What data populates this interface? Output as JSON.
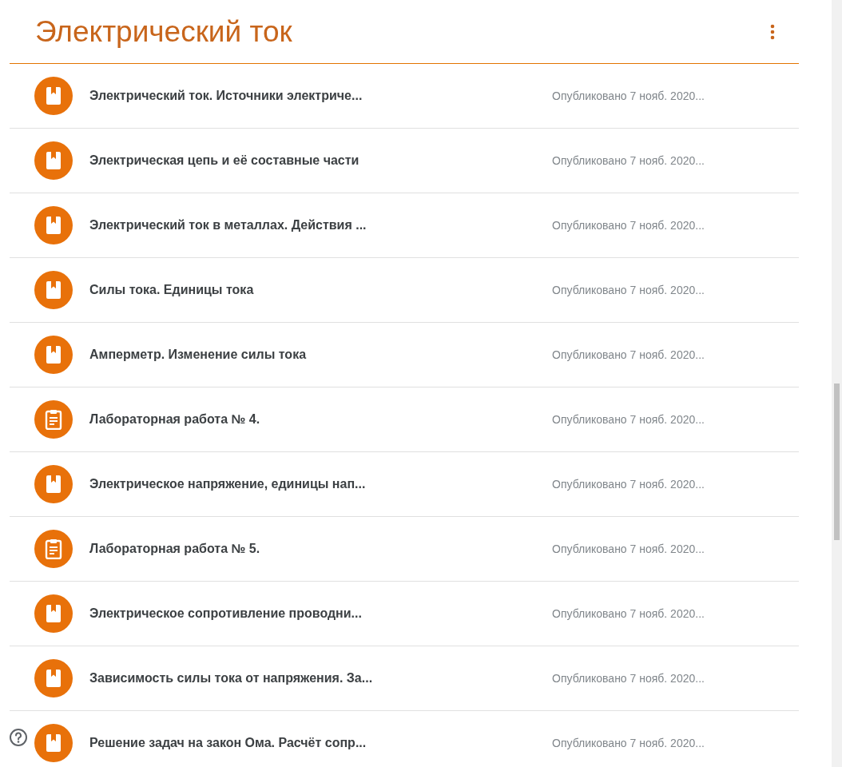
{
  "topic": {
    "title": "Электрический ток"
  },
  "items": [
    {
      "kind": "material",
      "title": "Электрический ток. Источники электриче...",
      "date": "Опубликовано 7 нояб. 2020..."
    },
    {
      "kind": "material",
      "title": "Электрическая цепь и её составные части",
      "date": "Опубликовано 7 нояб. 2020..."
    },
    {
      "kind": "material",
      "title": "Электрический ток в металлах. Действия ...",
      "date": "Опубликовано 7 нояб. 2020..."
    },
    {
      "kind": "material",
      "title": "Силы тока. Единицы тока",
      "date": "Опубликовано 7 нояб. 2020..."
    },
    {
      "kind": "material",
      "title": "Амперметр. Изменение силы тока",
      "date": "Опубликовано 7 нояб. 2020..."
    },
    {
      "kind": "assignment",
      "title": "Лабораторная работа № 4.",
      "date": "Опубликовано 7 нояб. 2020..."
    },
    {
      "kind": "material",
      "title": "Электрическое напряжение, единицы нап...",
      "date": "Опубликовано 7 нояб. 2020..."
    },
    {
      "kind": "assignment",
      "title": "Лабораторная работа № 5.",
      "date": "Опубликовано 7 нояб. 2020..."
    },
    {
      "kind": "material",
      "title": "Электрическое сопротивление проводни...",
      "date": "Опубликовано 7 нояб. 2020..."
    },
    {
      "kind": "material",
      "title": "Зависимость силы тока от напряжения. За...",
      "date": "Опубликовано 7 нояб. 2020..."
    },
    {
      "kind": "material",
      "title": "Решение задач на закон Ома. Расчёт сопр...",
      "date": "Опубликовано 7 нояб. 2020..."
    }
  ]
}
